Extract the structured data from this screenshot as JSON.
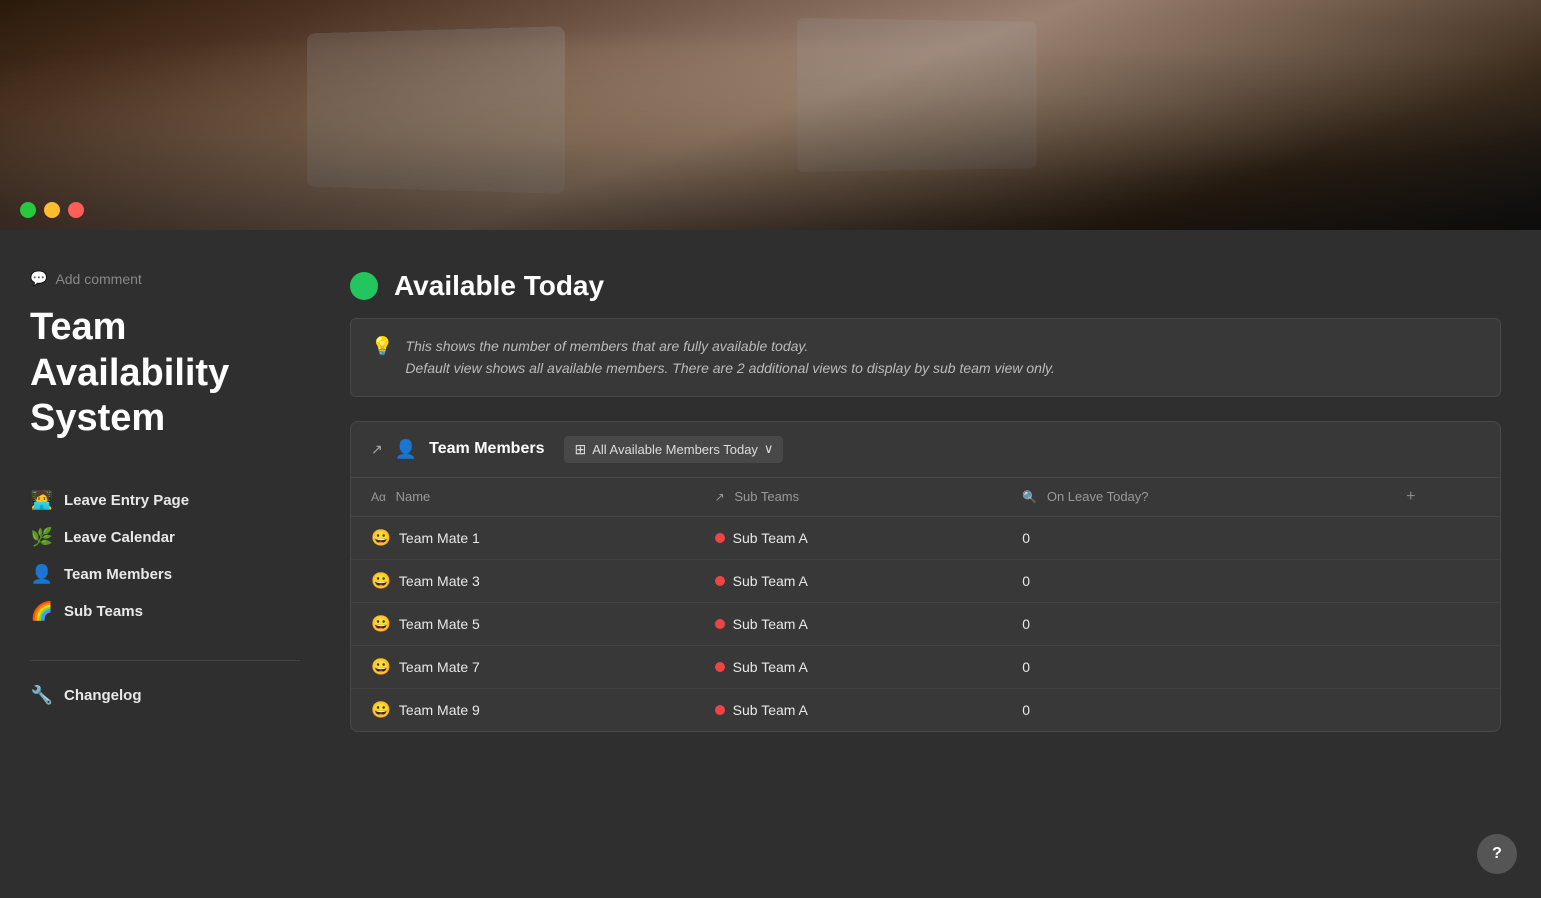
{
  "header": {
    "title": "Team Availability System",
    "add_comment_label": "Add comment"
  },
  "traffic_lights": {
    "green": "#28c840",
    "yellow": "#febc2e",
    "red": "#ff5f57"
  },
  "nav": {
    "items": [
      {
        "id": "leave-entry",
        "icon": "🧑‍💻",
        "label": "Leave Entry Page",
        "active": false
      },
      {
        "id": "leave-calendar",
        "icon": "🌿",
        "label": "Leave Calendar",
        "active": false
      },
      {
        "id": "team-members",
        "icon": "👤",
        "label": "Team Members",
        "active": false
      },
      {
        "id": "sub-teams",
        "icon": "🌈",
        "label": "Sub Teams",
        "active": false
      }
    ],
    "divider_items": [
      {
        "id": "changelog",
        "icon": "🔧",
        "label": "Changelog",
        "active": false
      }
    ]
  },
  "available_today": {
    "title": "Available Today",
    "info_text_line1": "This shows the number of members that are fully available today.",
    "info_text_line2": "Default view shows all available members. There are 2 additional views to display by sub team view only."
  },
  "team_members_section": {
    "title": "Team Members",
    "view_label": "All Available Members Today",
    "columns": [
      {
        "id": "name",
        "icon": "Aα",
        "label": "Name"
      },
      {
        "id": "sub-teams",
        "icon": "↗",
        "label": "Sub Teams"
      },
      {
        "id": "on-leave",
        "icon": "🔍",
        "label": "On Leave Today?"
      }
    ],
    "rows": [
      {
        "id": "tm1",
        "name": "Team Mate 1",
        "sub_team": "Sub Team A",
        "on_leave": "0"
      },
      {
        "id": "tm3",
        "name": "Team Mate 3",
        "sub_team": "Sub Team A",
        "on_leave": "0"
      },
      {
        "id": "tm5",
        "name": "Team Mate 5",
        "sub_team": "Sub Team A",
        "on_leave": "0"
      },
      {
        "id": "tm7",
        "name": "Team Mate 7",
        "sub_team": "Sub Team A",
        "on_leave": "0"
      },
      {
        "id": "tm9",
        "name": "Team Mate 9",
        "sub_team": "Sub Team A",
        "on_leave": "0"
      }
    ]
  },
  "help_button_label": "?"
}
